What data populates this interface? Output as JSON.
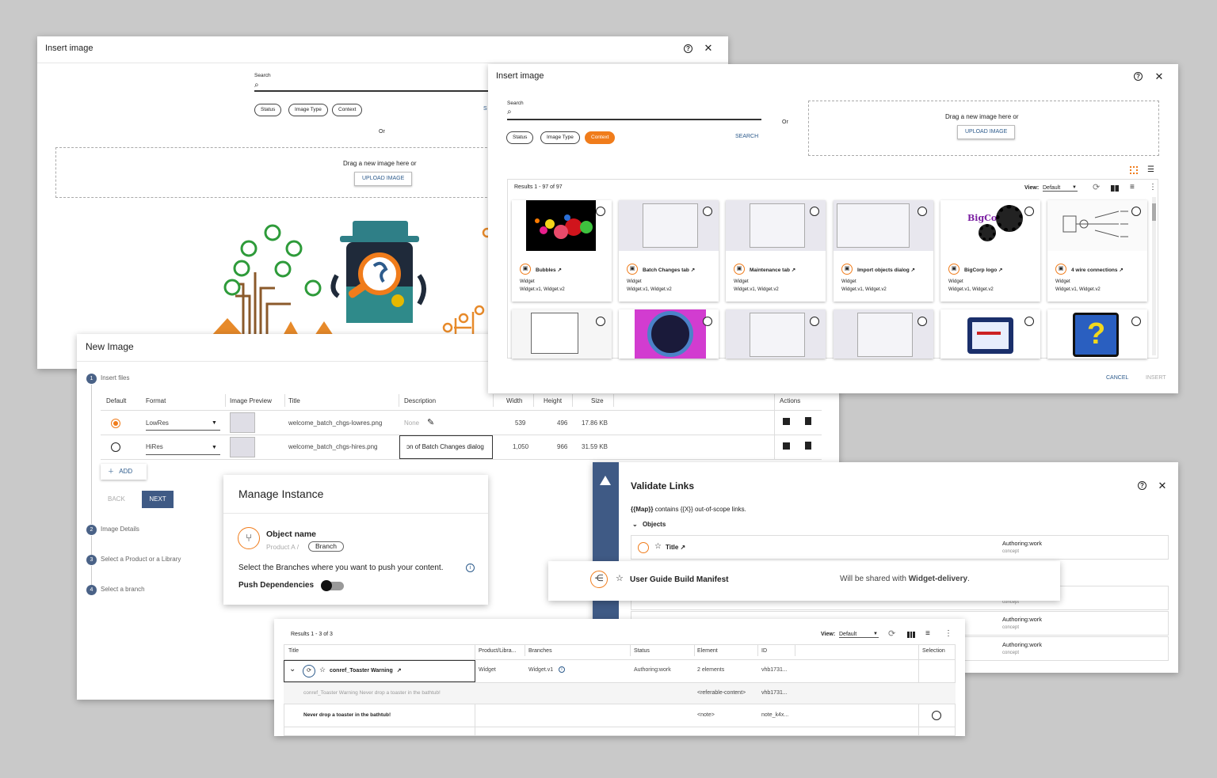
{
  "dlg1": {
    "title": "Insert image",
    "search_label": "Search",
    "chips": [
      "Status",
      "Image Type",
      "Context"
    ],
    "or": "Or",
    "drag_text": "Drag a new image here or",
    "upload_label": "UPLOAD IMAGE",
    "s_char": "S"
  },
  "dlg2": {
    "title": "Insert image",
    "search_label": "Search",
    "chips": [
      "Status",
      "Image Type",
      "Context"
    ],
    "active_chip": "Context",
    "search_button": "SEARCH",
    "or": "Or",
    "drag_text": "Drag a new image here or",
    "upload_label": "UPLOAD IMAGE",
    "results": "Results 1 - 97 of 97",
    "view_label": "View:",
    "view_value": "Default",
    "cards": [
      {
        "name": "Bubbles",
        "l1": "Widget",
        "l2": "Widget.v1, Widget.v2"
      },
      {
        "name": "Batch Changes tab",
        "l1": "Widget",
        "l2": "Widget.v1, Widget.v2"
      },
      {
        "name": "Maintenance tab",
        "l1": "Widget",
        "l2": "Widget.v1, Widget.v2"
      },
      {
        "name": "Import objects dialog",
        "l1": "Widget",
        "l2": "Widget.v1, Widget.v2"
      },
      {
        "name": "BigCorp logo",
        "l1": "Widget",
        "l2": "Widget.v1, Widget.v2"
      },
      {
        "name": "4 wire connections",
        "l1": "Widget",
        "l2": "Widget.v1, Widget.v2"
      }
    ],
    "bigcorp_text": "BigCorp",
    "cancel": "CANCEL",
    "insert": "INSERT"
  },
  "newimg": {
    "title": "New Image",
    "steps": [
      "Insert files",
      "Image Details",
      "Select a Product or a Library",
      "Select a branch"
    ],
    "columns": [
      "Default",
      "Format",
      "Image Preview",
      "Title",
      "Description",
      "Width",
      "Height",
      "Size",
      "Actions"
    ],
    "rows": [
      {
        "format": "LowRes",
        "title": "welcome_batch_chgs-lowres.png",
        "desc": "None",
        "width": "539",
        "height": "496",
        "size": "17.86 KB"
      },
      {
        "format": "HiRes",
        "title": "welcome_batch_chgs-hires.png",
        "desc": "ɔn of Batch Changes dialog",
        "width": "1,050",
        "height": "966",
        "size": "31.59 KB"
      }
    ],
    "add": "ADD",
    "back": "BACK",
    "next": "NEXT"
  },
  "manage": {
    "title": "Manage Instance",
    "object_name": "Object name",
    "product": "Product A /",
    "branch": "Branch",
    "instruction": "Select the Branches where you want to push your content.",
    "push": "Push Dependencies"
  },
  "validate": {
    "title": "Validate Links",
    "desc_map": "{{Map}}",
    "desc_rest": "contains {{X}} out-of-scope links.",
    "objects": "Objects",
    "row_title": "Title",
    "rows": [
      {
        "state": "Authoring:work",
        "type": "concept"
      },
      {
        "state": "Authoring:work",
        "type": "concept"
      },
      {
        "state": "Authoring:work",
        "type": "concept"
      },
      {
        "state": "Authoring:work",
        "type": "concept"
      }
    ]
  },
  "manifest": {
    "name": "User Guide Build Manifest",
    "shared_prefix": "Will be shared with",
    "shared_target": "Widget-delivery",
    "shared_suffix": "."
  },
  "results3": {
    "results": "Results 1 - 3 of 3",
    "view_label": "View:",
    "view_value": "Default",
    "columns": [
      "Title",
      "Product/Libra...",
      "Branches",
      "Status",
      "Element",
      "ID",
      "Selection"
    ],
    "row1": {
      "title": "conref_Toaster Warning",
      "product": "Widget",
      "branch": "Widget.v1",
      "status": "Authoring:work",
      "element": "2 elements",
      "id": "vhb1731..."
    },
    "row2": {
      "title": "conref_Toaster Warning Never drop a toaster in the bathtub!",
      "element": "<referable-content>",
      "id": "vhb1731..."
    },
    "row3": {
      "title": "Never drop a toaster in the bathtub!",
      "element": "<note>",
      "id": "note_k4x..."
    }
  },
  "colors": {
    "accent": "#f07c1b",
    "primary": "#2d5b8c",
    "sidebar": "#3f5a85"
  }
}
